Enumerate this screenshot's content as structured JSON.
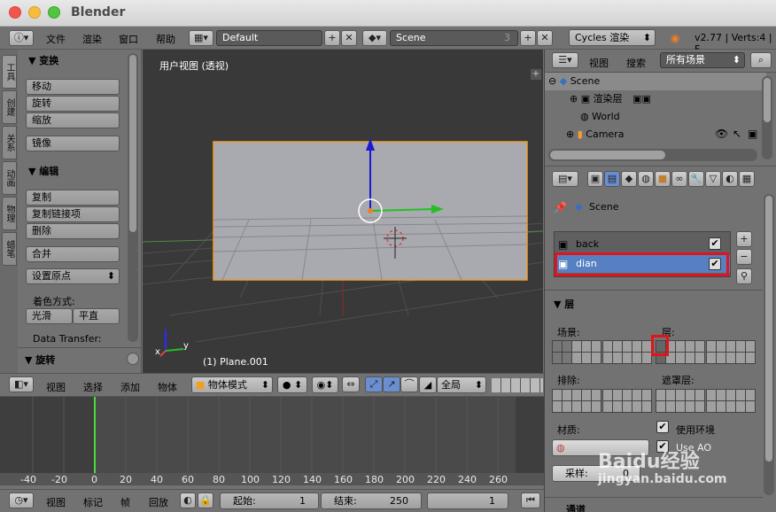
{
  "window": {
    "title": "Blender"
  },
  "topbar": {
    "menus": [
      "文件",
      "渲染",
      "窗口",
      "帮助"
    ],
    "screen": "Default",
    "scene": "Scene",
    "scene_count": "3",
    "engine": "Cycles 渲染",
    "stats": "v2.77 | Verts:4 | F"
  },
  "tools": {
    "tabs": [
      "工具",
      "创建",
      "关系",
      "动画",
      "物理",
      "蜡笔"
    ],
    "transform_header": "▼ 变换",
    "transform": [
      "移动",
      "旋转",
      "缩放"
    ],
    "mirror": "镜像",
    "edit_header": "▼ 编辑",
    "edit": [
      "复制",
      "复制链接项",
      "删除"
    ],
    "join": "合并",
    "set_origin": "设置原点",
    "shading_label": "着色方式:",
    "smooth": "光滑",
    "flat": "平直",
    "data_transfer": "Data Transfer:",
    "rotate_header": "▼ 旋转"
  },
  "viewport": {
    "label": "用户视图 (透视)",
    "object_label": "(1) Plane.001",
    "axis_x": "x",
    "axis_y": "y"
  },
  "vpbar": {
    "menus": [
      "视图",
      "选择",
      "添加",
      "物体"
    ],
    "mode": "物体模式",
    "pivot": "全局"
  },
  "timeline": {
    "ticks": [
      "-40",
      "-20",
      "0",
      "20",
      "40",
      "60",
      "80",
      "100",
      "120",
      "140",
      "160",
      "180",
      "200",
      "220",
      "240",
      "260"
    ],
    "menus": [
      "视图",
      "标记",
      "帧",
      "回放"
    ],
    "start_label": "起始:",
    "start_value": "1",
    "end_label": "结束:",
    "end_value": "250",
    "current_frame": "1"
  },
  "outliner": {
    "view": "视图",
    "search": "搜索",
    "filter": "所有场景",
    "rows": [
      "Scene",
      "渲染层",
      "World",
      "Camera"
    ]
  },
  "properties": {
    "scene_path": "Scene",
    "layers": [
      "back",
      "dian"
    ],
    "layer_header": "▼ 层",
    "scene_label": "场景:",
    "layer_label": "层:",
    "exclude_label": "排除:",
    "mask_label": "遮罩层:",
    "material_label": "材质:",
    "use_env": "使用环境",
    "use_ao": "Use AO",
    "samples_label": "采样:",
    "samples_value": "0",
    "pass_header": "通道",
    "watermark": "Baidu经验",
    "watermark_url": "jingyan.baidu.com"
  },
  "colors": {
    "selected_row": "#5680c2",
    "highlight_box": "#e0141e",
    "plane": "#a9a9b0",
    "plane_outline": "#f0a030"
  }
}
